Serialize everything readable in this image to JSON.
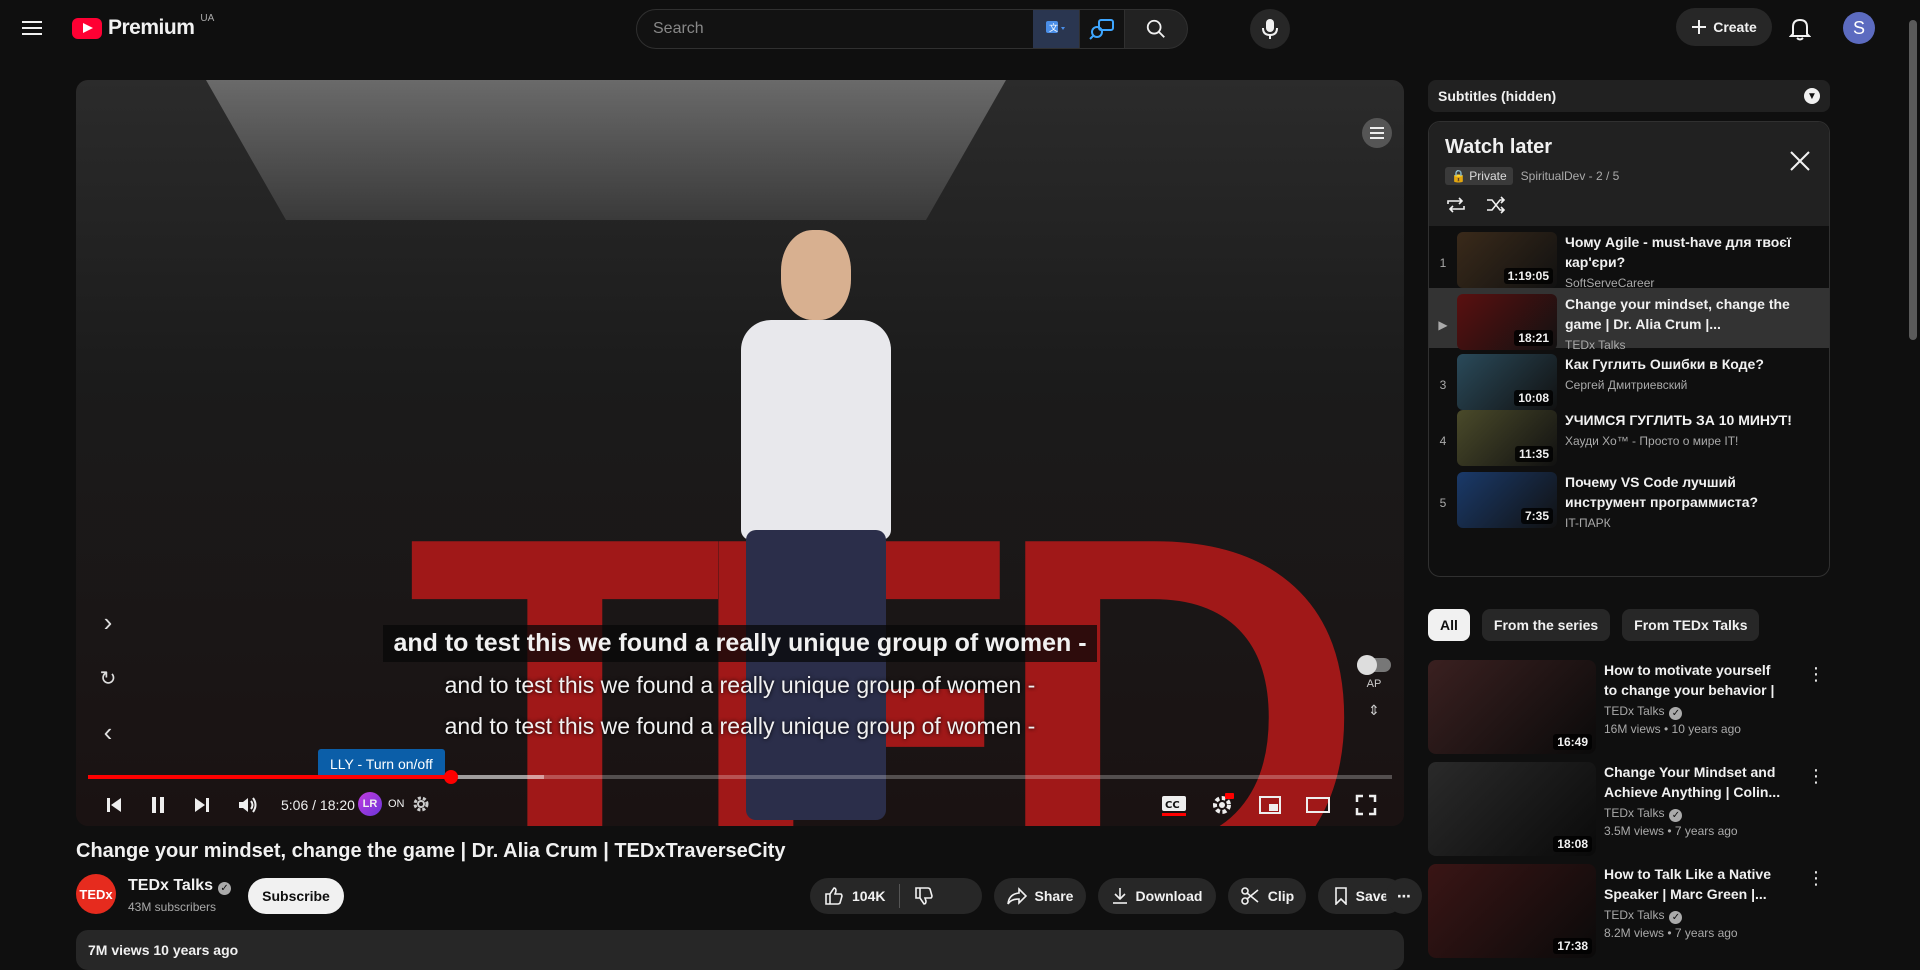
{
  "header": {
    "logo_text": "Premium",
    "country_code": "UA",
    "search_placeholder": "Search",
    "create_label": "Create",
    "avatar_letter": "S"
  },
  "player": {
    "captions": [
      "and to test this we found a really unique group of women -",
      "and to test this we found a really unique group of women -",
      "and to test this we found a really unique group of women -"
    ],
    "time_current": "5:06",
    "time_total": "18:20",
    "time_display": "5:06 / 18:20",
    "progress_fraction": 0.278,
    "buffered_fraction": 0.35,
    "tooltip": "LLY - Turn on/off",
    "lly_badge": "LR",
    "lly_state": "ON",
    "ap_label": "AP",
    "hd_badge": "HD"
  },
  "video": {
    "title": "Change your mindset, change the game | Dr. Alia Crum | TEDxTraverseCity",
    "channel": "TEDx Talks",
    "channel_avatar": "TEDx",
    "subscribers": "43M subscribers",
    "subscribe_label": "Subscribe",
    "likes": "104K",
    "share_label": "Share",
    "download_label": "Download",
    "clip_label": "Clip",
    "save_label": "Save",
    "description_meta": "7M views  10 years ago"
  },
  "sidebar": {
    "subtitles_panel": "Subtitles (hidden)",
    "playlist": {
      "title": "Watch later",
      "privacy": "Private",
      "owner_position": "SpiritualDev - 2 / 5",
      "items": [
        {
          "index": "1",
          "title": "Чому Agile - must-have для твоєї кар'єри?",
          "channel": "SoftServeCareer",
          "duration": "1:19:05",
          "color": "#3a2a1a"
        },
        {
          "index": "▶",
          "title": "Change your mindset, change the game | Dr. Alia Crum |...",
          "channel": "TEDx Talks",
          "duration": "18:21",
          "color": "#5a1010"
        },
        {
          "index": "3",
          "title": "Как Гуглить Ошибки в Коде?",
          "channel": "Сергей Дмитриевский",
          "duration": "10:08",
          "color": "#2a4a5a"
        },
        {
          "index": "4",
          "title": "УЧИМСЯ ГУГЛИТЬ ЗА 10 МИНУТ!",
          "channel": "Хауди Хо™ - Просто о мире IT!",
          "duration": "11:35",
          "color": "#4a4a2a"
        },
        {
          "index": "5",
          "title": "Почему VS Code лучший инструмент программиста?",
          "channel": "IT-ПАРК",
          "duration": "7:35",
          "color": "#1a3a6a"
        }
      ]
    },
    "chips": [
      "All",
      "From the series",
      "From TEDx Talks"
    ],
    "recommendations": [
      {
        "title": "How to motivate yourself to change your behavior | Tali...",
        "channel": "TEDx Talks",
        "meta": "16M views • 10 years ago",
        "duration": "16:49",
        "color": "#3a2020"
      },
      {
        "title": "Change Your Mindset and Achieve Anything | Colin...",
        "channel": "TEDx Talks",
        "meta": "3.5M views • 7 years ago",
        "duration": "18:08",
        "color": "#2a2a2a"
      },
      {
        "title": "How to Talk Like a Native Speaker | Marc Green |...",
        "channel": "TEDx Talks",
        "meta": "8.2M views • 7 years ago",
        "duration": "17:38",
        "color": "#3a1515"
      }
    ]
  }
}
